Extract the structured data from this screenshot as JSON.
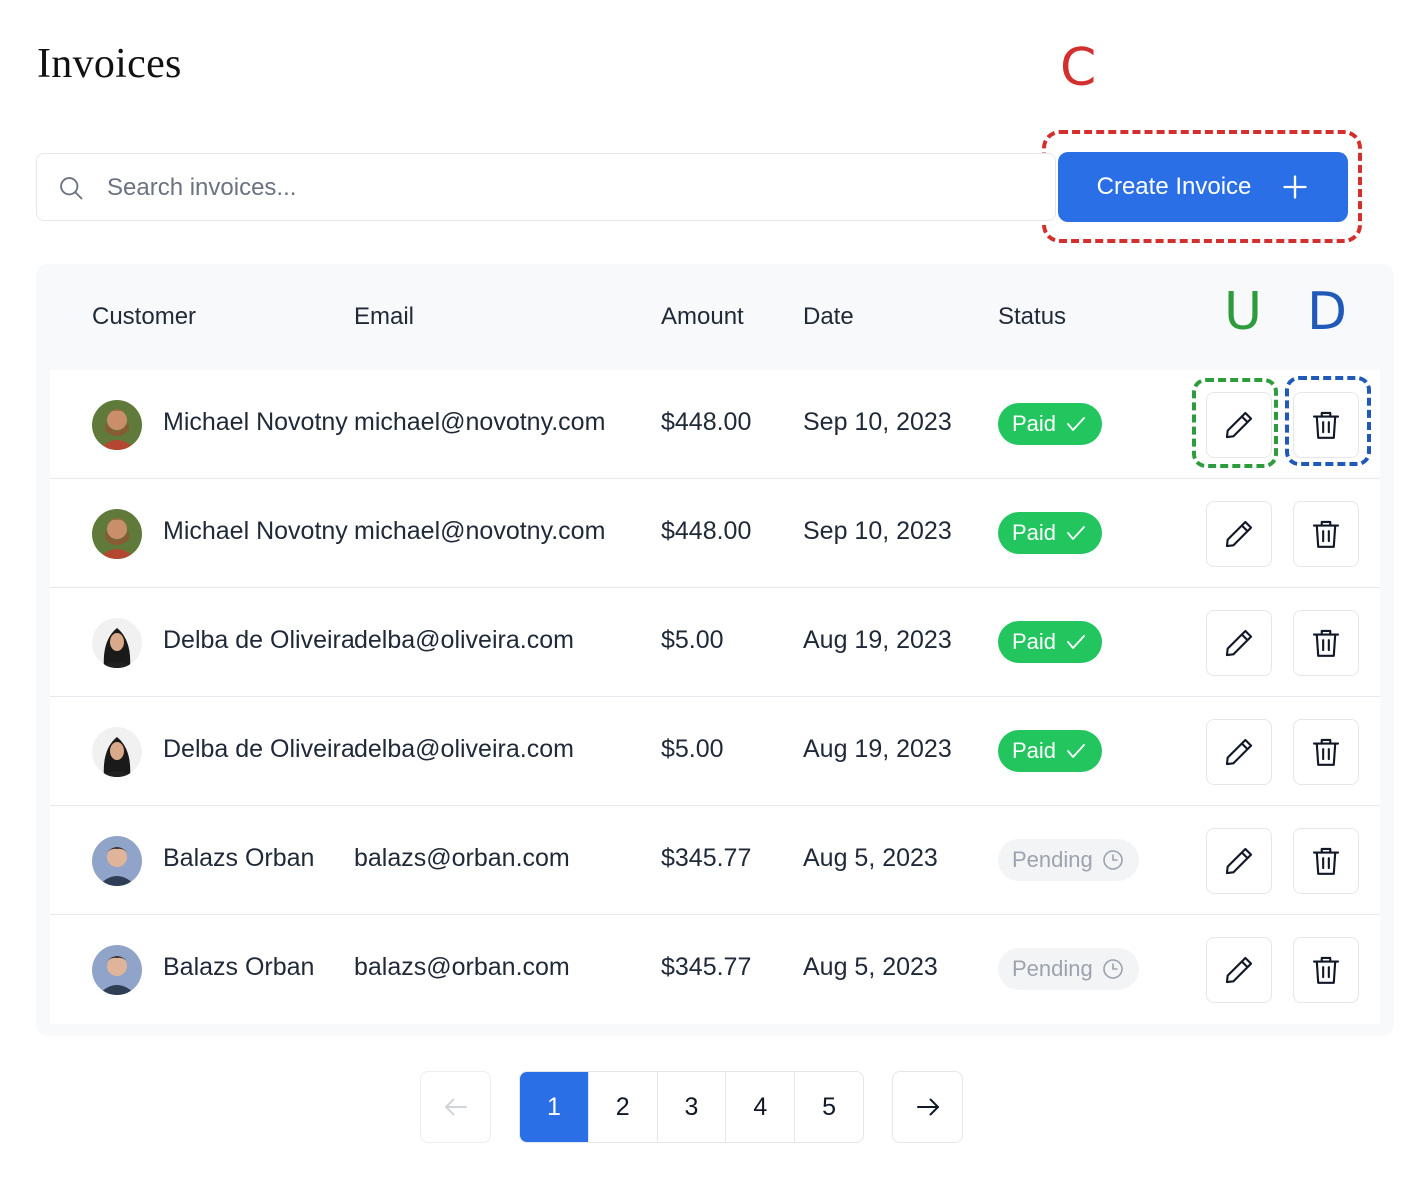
{
  "header": {
    "title": "Invoices"
  },
  "annotations": {
    "create": "C",
    "update": "U",
    "delete": "D"
  },
  "search": {
    "placeholder": "Search invoices..."
  },
  "toolbar": {
    "create_label": "Create Invoice",
    "create_icon": "plus-icon"
  },
  "table": {
    "columns": [
      "Customer",
      "Email",
      "Amount",
      "Date",
      "Status"
    ],
    "rows": [
      {
        "customer": "Michael Novotny",
        "email": "michael@novotny.com",
        "amount": "$448.00",
        "date": "Sep 10, 2023",
        "status": "Paid",
        "status_icon": "check-icon"
      },
      {
        "customer": "Michael Novotny",
        "email": "michael@novotny.com",
        "amount": "$448.00",
        "date": "Sep 10, 2023",
        "status": "Paid",
        "status_icon": "check-icon"
      },
      {
        "customer": "Delba de Oliveira",
        "email": "delba@oliveira.com",
        "amount": "$5.00",
        "date": "Aug 19, 2023",
        "status": "Paid",
        "status_icon": "check-icon"
      },
      {
        "customer": "Delba de Oliveira",
        "email": "delba@oliveira.com",
        "amount": "$5.00",
        "date": "Aug 19, 2023",
        "status": "Paid",
        "status_icon": "check-icon"
      },
      {
        "customer": "Balazs Orban",
        "email": "balazs@orban.com",
        "amount": "$345.77",
        "date": "Aug 5, 2023",
        "status": "Pending",
        "status_icon": "clock-icon"
      },
      {
        "customer": "Balazs Orban",
        "email": "balazs@orban.com",
        "amount": "$345.77",
        "date": "Aug 5, 2023",
        "status": "Pending",
        "status_icon": "clock-icon"
      }
    ]
  },
  "pagination": {
    "pages": [
      "1",
      "2",
      "3",
      "4",
      "5"
    ],
    "current": "1"
  },
  "colors": {
    "primary": "#2b6fe6",
    "paid": "#22c55e",
    "annotation_c": "#d32f2f",
    "annotation_u": "#2e9c3d",
    "annotation_d": "#2059b8"
  }
}
